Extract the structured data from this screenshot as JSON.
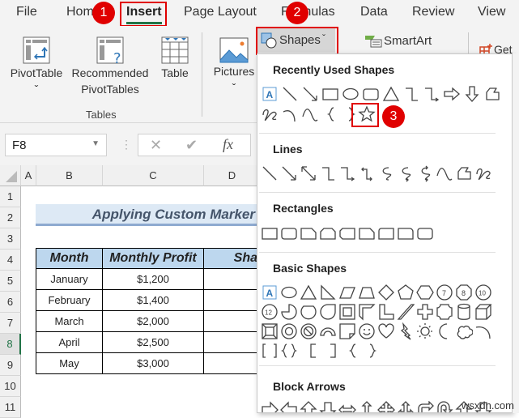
{
  "tabs": [
    "File",
    "Home",
    "Insert",
    "Page Layout",
    "Formulas",
    "Data",
    "Review",
    "View"
  ],
  "active_tab": "Insert",
  "ribbon": {
    "pivot_table": "PivotTable",
    "recommended": [
      "Recommended",
      "PivotTables"
    ],
    "table": "Table",
    "group_tables": "Tables",
    "pictures": "Pictures",
    "shapes": "Shapes",
    "smartart": "SmartArt",
    "get": "Get",
    "chevron": "ˇ"
  },
  "formula_bar": {
    "name_box": "F8",
    "cancel": "✕",
    "enter": "✔",
    "fx": "fx"
  },
  "columns": [
    "A",
    "B",
    "C",
    "D"
  ],
  "rows": [
    "1",
    "2",
    "3",
    "4",
    "5",
    "6",
    "7",
    "8",
    "9",
    "10",
    "11"
  ],
  "sheet": {
    "title": "Applying Custom Marker",
    "headers": [
      "Month",
      "Monthly Profit",
      "Sha"
    ],
    "data": [
      [
        "January",
        "$1,200"
      ],
      [
        "February",
        "$1,400"
      ],
      [
        "March",
        "$2,000"
      ],
      [
        "April",
        "$2,500"
      ],
      [
        "May",
        "$3,000"
      ]
    ]
  },
  "dropdown": {
    "sections": [
      "Recently Used Shapes",
      "Lines",
      "Rectangles",
      "Basic Shapes",
      "Block Arrows"
    ],
    "selected_shape": "star-5-point"
  },
  "steps": [
    "1",
    "2",
    "3"
  ],
  "watermark": "wsxdn.com",
  "colors": {
    "accent_red": "#e00000",
    "header_fill": "#bdd7ee",
    "title_fill": "#dde9f5",
    "title_text": "#44546a",
    "excel_green": "#217346"
  }
}
